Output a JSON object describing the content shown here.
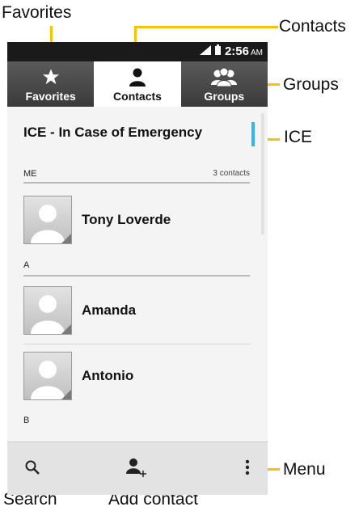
{
  "callouts": {
    "favorites": "Favorites",
    "contacts": "Contacts",
    "groups": "Groups",
    "ice": "ICE",
    "menu": "Menu",
    "search": "Search",
    "add_contact": "Add contact"
  },
  "status_bar": {
    "time": "2:56",
    "ampm": "AM"
  },
  "tabs": [
    {
      "label": "Favorites",
      "icon": "star-icon",
      "active": false
    },
    {
      "label": "Contacts",
      "icon": "person-icon",
      "active": true
    },
    {
      "label": "Groups",
      "icon": "group-icon",
      "active": false
    }
  ],
  "ice": {
    "label": "ICE - In Case of Emergency"
  },
  "sections": [
    {
      "header": "ME",
      "count": "3 contacts",
      "contacts": [
        "Tony Loverde"
      ]
    },
    {
      "header": "A",
      "count": "",
      "contacts": [
        "Amanda",
        "Antonio"
      ]
    },
    {
      "header": "B",
      "count": "",
      "contacts": []
    }
  ],
  "bottom_bar": {
    "icons": [
      "search-icon",
      "add-contact-icon",
      "menu-icon"
    ]
  },
  "colors": {
    "accent": "#f5c400",
    "ice_accent": "#33b5e5",
    "status_bar": "#1a1a1a",
    "tab_bar": "#3a3a3a"
  }
}
